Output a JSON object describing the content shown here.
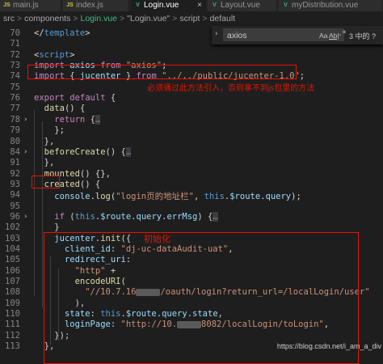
{
  "tabs": [
    {
      "label": "main.js",
      "icon": "JS",
      "icon_color": "#cbcb41"
    },
    {
      "label": "index.js",
      "icon": "JS",
      "icon_color": "#cbcb41"
    },
    {
      "label": "Login.vue",
      "icon": "V",
      "icon_color": "#41b883",
      "active": true,
      "close": "×"
    },
    {
      "label": "Layout.vue",
      "icon": "V",
      "icon_color": "#41b883"
    },
    {
      "label": "myDistribution.vue",
      "icon": "V",
      "icon_color": "#41b883"
    }
  ],
  "breadcrumb": {
    "items": [
      "src",
      "components",
      "Login.vue",
      "\"Login.vue\"",
      "script",
      "default"
    ],
    "separator": ">"
  },
  "find": {
    "value": "axios",
    "match_case": "Aa",
    "whole_word": "Ab|",
    "regex": ".*",
    "result": "3 中的 ?"
  },
  "code_lines": [
    {
      "n": "70",
      "text": "</template>"
    },
    {
      "n": "71",
      "text": ""
    },
    {
      "n": "72",
      "text": "<script>"
    },
    {
      "n": "73",
      "text": "import axios from \"axios\";"
    },
    {
      "n": "74",
      "text": "import { jucenter } from \"../../public/jucenter-1.0\";"
    },
    {
      "n": "75",
      "text": ""
    },
    {
      "n": "76",
      "text": "export default {"
    },
    {
      "n": "77",
      "text": "  data() {"
    },
    {
      "n": "78",
      "text": "    return {…"
    },
    {
      "n": "79",
      "text": "    };"
    },
    {
      "n": "80",
      "text": "  },"
    },
    {
      "n": "84",
      "text": "  beforeCreate() {…"
    },
    {
      "n": "91",
      "text": "  },"
    },
    {
      "n": "92",
      "text": "  mounted() {},"
    },
    {
      "n": "93",
      "text": "  created() {"
    },
    {
      "n": "94",
      "text": "    console.log(\"login页的地址栏\", this.$route.query);"
    },
    {
      "n": "95",
      "text": ""
    },
    {
      "n": "96",
      "text": "    if (this.$route.query.errMsg) {…"
    },
    {
      "n": "102",
      "text": "    }"
    },
    {
      "n": "103",
      "text": "    jucenter.init({"
    },
    {
      "n": "104",
      "text": "      client_id: \"dj-uc-dataAudit-uat\","
    },
    {
      "n": "105",
      "text": "      redirect_uri:"
    },
    {
      "n": "106",
      "text": "        \"http\" +"
    },
    {
      "n": "107",
      "text": "        encodeURI("
    },
    {
      "n": "108",
      "text": "          \"//10.7.16[blurred]/oauth/login?return_url=/localLogin/user\""
    },
    {
      "n": "109",
      "text": "        ),"
    },
    {
      "n": "110",
      "text": "      state: this.$route.query.state,"
    },
    {
      "n": "111",
      "text": "      loginPage: \"http://10.[blurred]8082/localLogin/toLogin\","
    },
    {
      "n": "112",
      "text": "    });"
    },
    {
      "n": "113",
      "text": "  },"
    }
  ],
  "annotations": {
    "import_note": "必须通过此方法引入，否则拿不到js包里的方法",
    "init_note": "初始化"
  },
  "watermark": "https://blog.csdn.net/i_am_a_div",
  "colors": {
    "annotation": "#e51400",
    "keyword": "#569cd6",
    "string": "#ce9178",
    "function": "#dcdcaa",
    "variable": "#9cdcfe"
  }
}
